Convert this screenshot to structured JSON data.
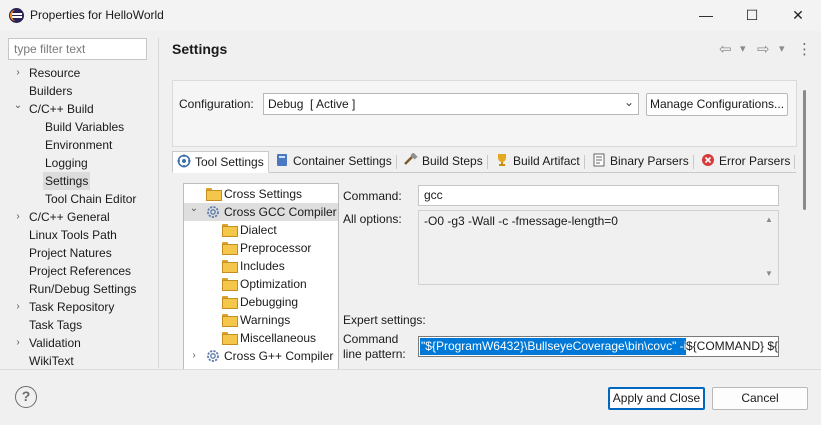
{
  "window": {
    "title": "Properties for HelloWorld",
    "minimize": "—",
    "maximize": "☐",
    "close": "✕"
  },
  "filter": {
    "placeholder": "type filter text"
  },
  "nav_tree": [
    {
      "label": "Resource",
      "twisty": "›"
    },
    {
      "label": "Builders",
      "twisty": ""
    },
    {
      "label": "C/C++ Build",
      "twisty": "⌄"
    },
    {
      "label": "Build Variables",
      "twisty": ""
    },
    {
      "label": "Environment",
      "twisty": ""
    },
    {
      "label": "Logging",
      "twisty": ""
    },
    {
      "label": "Settings",
      "twisty": ""
    },
    {
      "label": "Tool Chain Editor",
      "twisty": ""
    },
    {
      "label": "C/C++ General",
      "twisty": "›"
    },
    {
      "label": "Linux Tools Path",
      "twisty": ""
    },
    {
      "label": "Project Natures",
      "twisty": ""
    },
    {
      "label": "Project References",
      "twisty": ""
    },
    {
      "label": "Run/Debug Settings",
      "twisty": ""
    },
    {
      "label": "Task Repository",
      "twisty": "›"
    },
    {
      "label": "Task Tags",
      "twisty": ""
    },
    {
      "label": "Validation",
      "twisty": "›"
    },
    {
      "label": "WikiText",
      "twisty": ""
    }
  ],
  "page": {
    "title": "Settings",
    "nav_back": "⇦",
    "nav_forward": "⇨",
    "nav_dropdown": "▾",
    "menu": "⋮"
  },
  "configuration": {
    "label": "Configuration:",
    "value": "Debug  [ Active ]",
    "chevron": "⌄",
    "manage_button": "Manage Configurations..."
  },
  "tabs": [
    {
      "label": "Tool Settings",
      "icon": "tool-settings-icon",
      "active": true
    },
    {
      "label": "Container Settings",
      "icon": "container-icon",
      "active": false
    },
    {
      "label": "Build Steps",
      "icon": "build-steps-icon",
      "active": false
    },
    {
      "label": "Build Artifact",
      "icon": "trophy-icon",
      "active": false
    },
    {
      "label": "Binary Parsers",
      "icon": "binary-parsers-icon",
      "active": false
    },
    {
      "label": "Error Parsers",
      "icon": "error-icon",
      "active": false
    }
  ],
  "tool_tree": [
    {
      "label": "Cross Settings",
      "icon": "folder-icon",
      "twisty": ""
    },
    {
      "label": "Cross GCC Compiler",
      "icon": "gear-icon",
      "twisty": "⌄"
    },
    {
      "label": "Dialect",
      "icon": "folder-icon",
      "twisty": ""
    },
    {
      "label": "Preprocessor",
      "icon": "folder-icon",
      "twisty": ""
    },
    {
      "label": "Includes",
      "icon": "folder-icon",
      "twisty": ""
    },
    {
      "label": "Optimization",
      "icon": "folder-icon",
      "twisty": ""
    },
    {
      "label": "Debugging",
      "icon": "folder-icon",
      "twisty": ""
    },
    {
      "label": "Warnings",
      "icon": "folder-icon",
      "twisty": ""
    },
    {
      "label": "Miscellaneous",
      "icon": "folder-icon",
      "twisty": ""
    },
    {
      "label": "Cross G++ Compiler",
      "icon": "gear-icon",
      "twisty": "›"
    }
  ],
  "tool_settings": {
    "command_label": "Command:",
    "command_value": "gcc",
    "all_options_label": "All options:",
    "all_options_value": "-O0 -g3 -Wall -c -fmessage-length=0",
    "scroll_up": "▲",
    "scroll_down": "▼",
    "expert_label": "Expert settings:",
    "pattern_label_1": "Command",
    "pattern_label_2": "line pattern:",
    "pattern_selected": "\"${ProgramW6432}\\BullseyeCoverage\\bin\\covc\" -i",
    "pattern_rest": "${COMMAND} ${"
  },
  "footer": {
    "help": "?",
    "apply_button": "Apply and Close",
    "cancel_button": "Cancel"
  }
}
